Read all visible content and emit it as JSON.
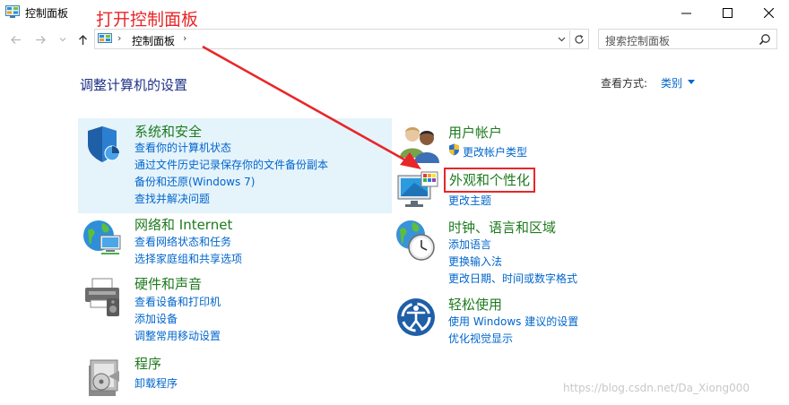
{
  "window": {
    "title": "控制面板",
    "annotation": "打开控制面板"
  },
  "address": {
    "breadcrumb": "控制面板",
    "sep1": "›",
    "sep2": "›"
  },
  "search": {
    "placeholder": "搜索控制面板"
  },
  "page": {
    "heading": "调整计算机的设置",
    "view_by_label": "查看方式:",
    "view_by_value": "类别"
  },
  "left_categories": [
    {
      "title": "系统和安全",
      "icon": "shield-icon",
      "links": [
        "查看你的计算机状态",
        "通过文件历史记录保存你的文件备份副本",
        "备份和还原(Windows 7)",
        "查找并解决问题"
      ]
    },
    {
      "title": "网络和 Internet",
      "icon": "network-globe-icon",
      "links": [
        "查看网络状态和任务",
        "选择家庭组和共享选项"
      ]
    },
    {
      "title": "硬件和声音",
      "icon": "printer-icon",
      "links": [
        "查看设备和打印机",
        "添加设备",
        "调整常用移动设置"
      ]
    },
    {
      "title": "程序",
      "icon": "programs-icon",
      "links": [
        "卸载程序"
      ]
    }
  ],
  "right_categories": [
    {
      "title": "用户帐户",
      "icon": "users-icon",
      "links": [
        "更改帐户类型"
      ]
    },
    {
      "title": "外观和个性化",
      "icon": "display-palette-icon",
      "links": [
        "更改主题"
      ]
    },
    {
      "title": "时钟、语言和区域",
      "icon": "clock-globe-icon",
      "links": [
        "添加语言",
        "更换输入法",
        "更改日期、时间或数字格式"
      ]
    },
    {
      "title": "轻松使用",
      "icon": "ease-of-access-icon",
      "links": [
        "使用 Windows 建议的设置",
        "优化视觉显示"
      ]
    }
  ],
  "watermark": "https://blog.csdn.net/Da_Xiong000",
  "colors": {
    "link": "#0066cc",
    "category_title": "#1e7b1e",
    "annotation": "#e8262a",
    "highlight": "#e5f3fb"
  }
}
